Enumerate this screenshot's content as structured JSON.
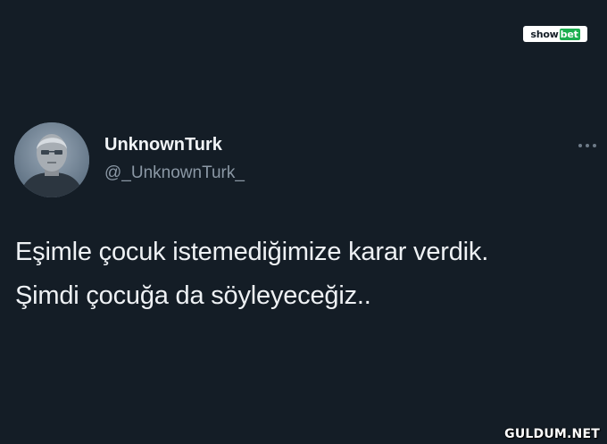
{
  "logo": {
    "brand_part1": "show",
    "brand_part2": "bet"
  },
  "tweet": {
    "display_name": "UnknownTurk",
    "handle": "@_UnknownTurk_",
    "text_lines": [
      "Eşimle çocuk istemediğimize karar verdik.",
      "Şimdi çocuğa da söyleyeceğiz.."
    ],
    "avatar_icon": "profile-photo",
    "more_icon": "more-horizontal-icon"
  },
  "watermark": {
    "text": "GULDUM.NET"
  },
  "colors": {
    "background": "#141d26",
    "text_primary": "#eef1f4",
    "text_secondary": "#8b98a5",
    "logo_green": "#1cae4f"
  }
}
